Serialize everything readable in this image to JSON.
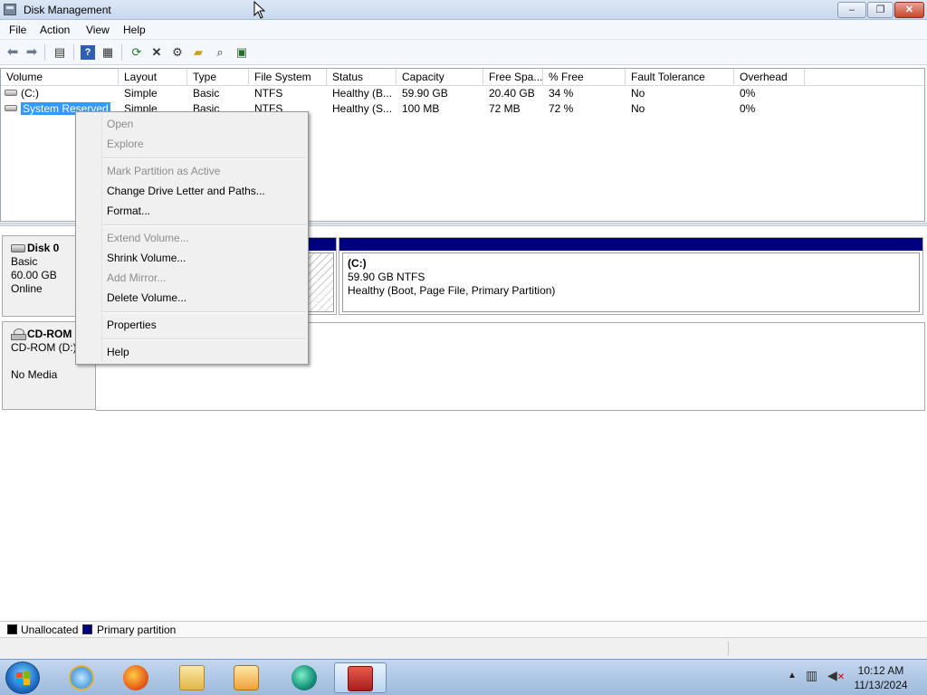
{
  "window": {
    "title": "Disk Management",
    "minimize_glyph": "‒",
    "maximize_glyph": "❐",
    "close_glyph": "✕"
  },
  "menubar": {
    "items": [
      "File",
      "Action",
      "View",
      "Help"
    ]
  },
  "toolbar": {
    "icons": [
      "back-arrow-icon",
      "forward-arrow-icon",
      "console-tree-icon",
      "help-icon",
      "properties-icon",
      "refresh-icon",
      "delete-icon",
      "settings-icon",
      "open-folder-icon",
      "search-icon",
      "disk-icon"
    ]
  },
  "volume_list": {
    "columns": [
      "Volume",
      "Layout",
      "Type",
      "File System",
      "Status",
      "Capacity",
      "Free Spa...",
      "% Free",
      "Fault Tolerance",
      "Overhead"
    ],
    "rows": [
      {
        "volume": "(C:)",
        "layout": "Simple",
        "type": "Basic",
        "fs": "NTFS",
        "status": "Healthy (B...",
        "capacity": "59.90 GB",
        "free": "20.40 GB",
        "pct": "34 %",
        "fault": "No",
        "overhead": "0%"
      },
      {
        "volume": "System Reserved",
        "layout": "Simple",
        "type": "Basic",
        "fs": "NTFS",
        "status": "Healthy (S...",
        "capacity": "100 MB",
        "free": "72 MB",
        "pct": "72 %",
        "fault": "No",
        "overhead": "0%"
      }
    ]
  },
  "disks": {
    "disk0": {
      "name": "Disk 0",
      "type": "Basic",
      "size": "60.00 GB",
      "state": "Online"
    },
    "cdrom": {
      "name": "CD-ROM 0",
      "drive": "CD-ROM (D:)",
      "media": "No Media"
    },
    "partition_c": {
      "label": "(C:)",
      "size_fs": "59.90 GB NTFS",
      "status": "Healthy (Boot, Page File, Primary Partition)"
    }
  },
  "context_menu": {
    "open": "Open",
    "explore": "Explore",
    "mark_active": "Mark Partition as Active",
    "change_letter": "Change Drive Letter and Paths...",
    "format": "Format...",
    "extend": "Extend Volume...",
    "shrink": "Shrink Volume...",
    "add_mirror": "Add Mirror...",
    "delete": "Delete Volume...",
    "properties": "Properties",
    "help": "Help"
  },
  "legend": {
    "unallocated": "Unallocated",
    "primary": "Primary partition",
    "unallocated_color": "#000000",
    "primary_color": "#00007f"
  },
  "taskbar": {
    "apps": [
      "internet-explorer-icon",
      "firefox-icon",
      "file-explorer-icon",
      "media-player-icon",
      "chat-icon",
      "computer-management-icon"
    ],
    "clock_time": "10:12 AM",
    "clock_date": "11/13/2024"
  },
  "colors": {
    "partition_band": "#00007f",
    "selection": "#3399ff"
  }
}
